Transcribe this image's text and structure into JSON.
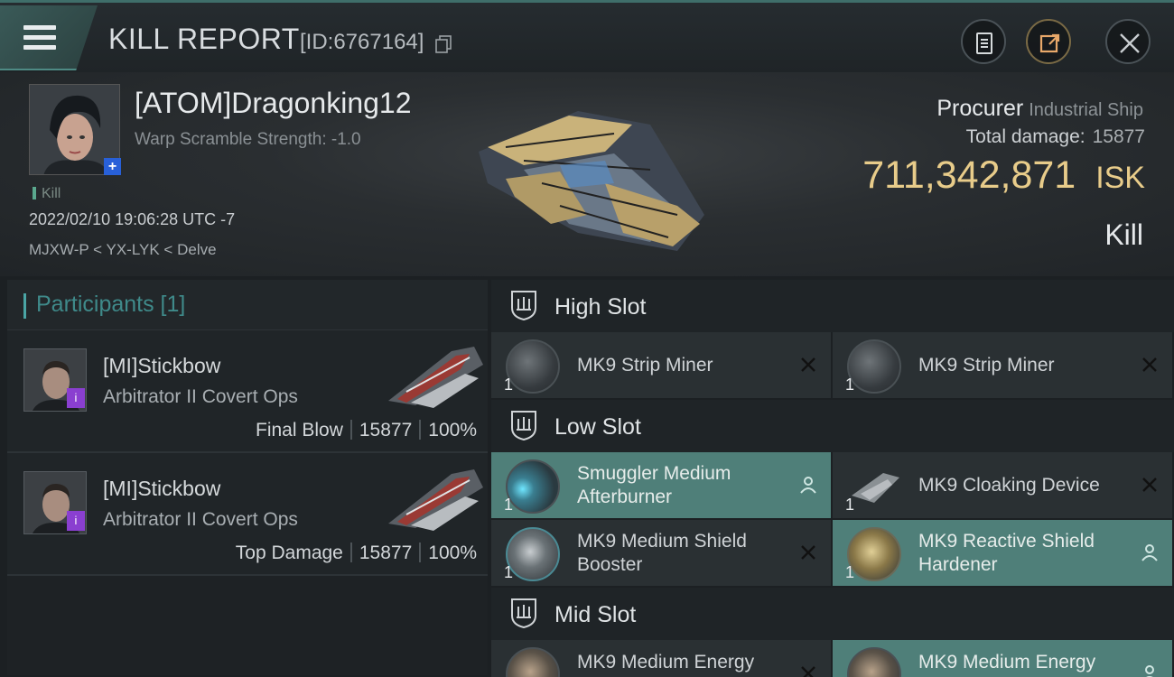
{
  "header": {
    "title": "KILL REPORT",
    "report_id": "[ID:6767164]"
  },
  "victim": {
    "name": "[ATOM]Dragonking12",
    "warp_scramble": "Warp Scramble Strength: -1.0",
    "tag": "Kill",
    "datetime": "2022/02/10 19:06:28 UTC -7",
    "location": "MJXW-P < YX-LYK < Delve",
    "ship_name": "Procurer",
    "ship_class": "Industrial Ship",
    "total_damage_label": "Total damage:",
    "total_damage": "15877",
    "isk_value": "711,342,871",
    "isk_unit": "ISK",
    "result": "Kill"
  },
  "participants": {
    "title": "Participants [1]",
    "rows": [
      {
        "name": "[MI]Stickbow",
        "ship": "Arbitrator II Covert Ops",
        "role": "Final Blow",
        "damage": "15877",
        "percent": "100%"
      },
      {
        "name": "[MI]Stickbow",
        "ship": "Arbitrator II Covert Ops",
        "role": "Top Damage",
        "damage": "15877",
        "percent": "100%"
      }
    ]
  },
  "slots": {
    "high": {
      "label": "High Slot",
      "items": [
        {
          "name": "MK9 Strip Miner",
          "qty": "1",
          "status": "destroyed"
        },
        {
          "name": "MK9 Strip Miner",
          "qty": "1",
          "status": "destroyed"
        }
      ]
    },
    "low": {
      "label": "Low Slot",
      "items": [
        {
          "name_line1": "Smuggler Medium",
          "name_line2": "Afterburner",
          "qty": "1",
          "status": "dropped"
        },
        {
          "name_line1": "MK9 Cloaking Device",
          "name_line2": "",
          "qty": "1",
          "status": "destroyed"
        },
        {
          "name_line1": "MK9 Medium Shield",
          "name_line2": "Booster",
          "qty": "1",
          "status": "destroyed"
        },
        {
          "name_line1": "MK9 Reactive Shield",
          "name_line2": "Hardener",
          "qty": "1",
          "status": "dropped"
        }
      ]
    },
    "mid": {
      "label": "Mid Slot",
      "items": [
        {
          "name": "MK9 Medium Energy",
          "status": "destroyed"
        },
        {
          "name": "MK9 Medium Energy",
          "status": "dropped"
        }
      ]
    }
  },
  "colors": {
    "accent": "#4aa5a5",
    "isk": "#e8cc8a",
    "dropped_bg": "#4f7f79",
    "rank_badge": "#8a3fd0",
    "plus_badge": "#2860d8"
  }
}
